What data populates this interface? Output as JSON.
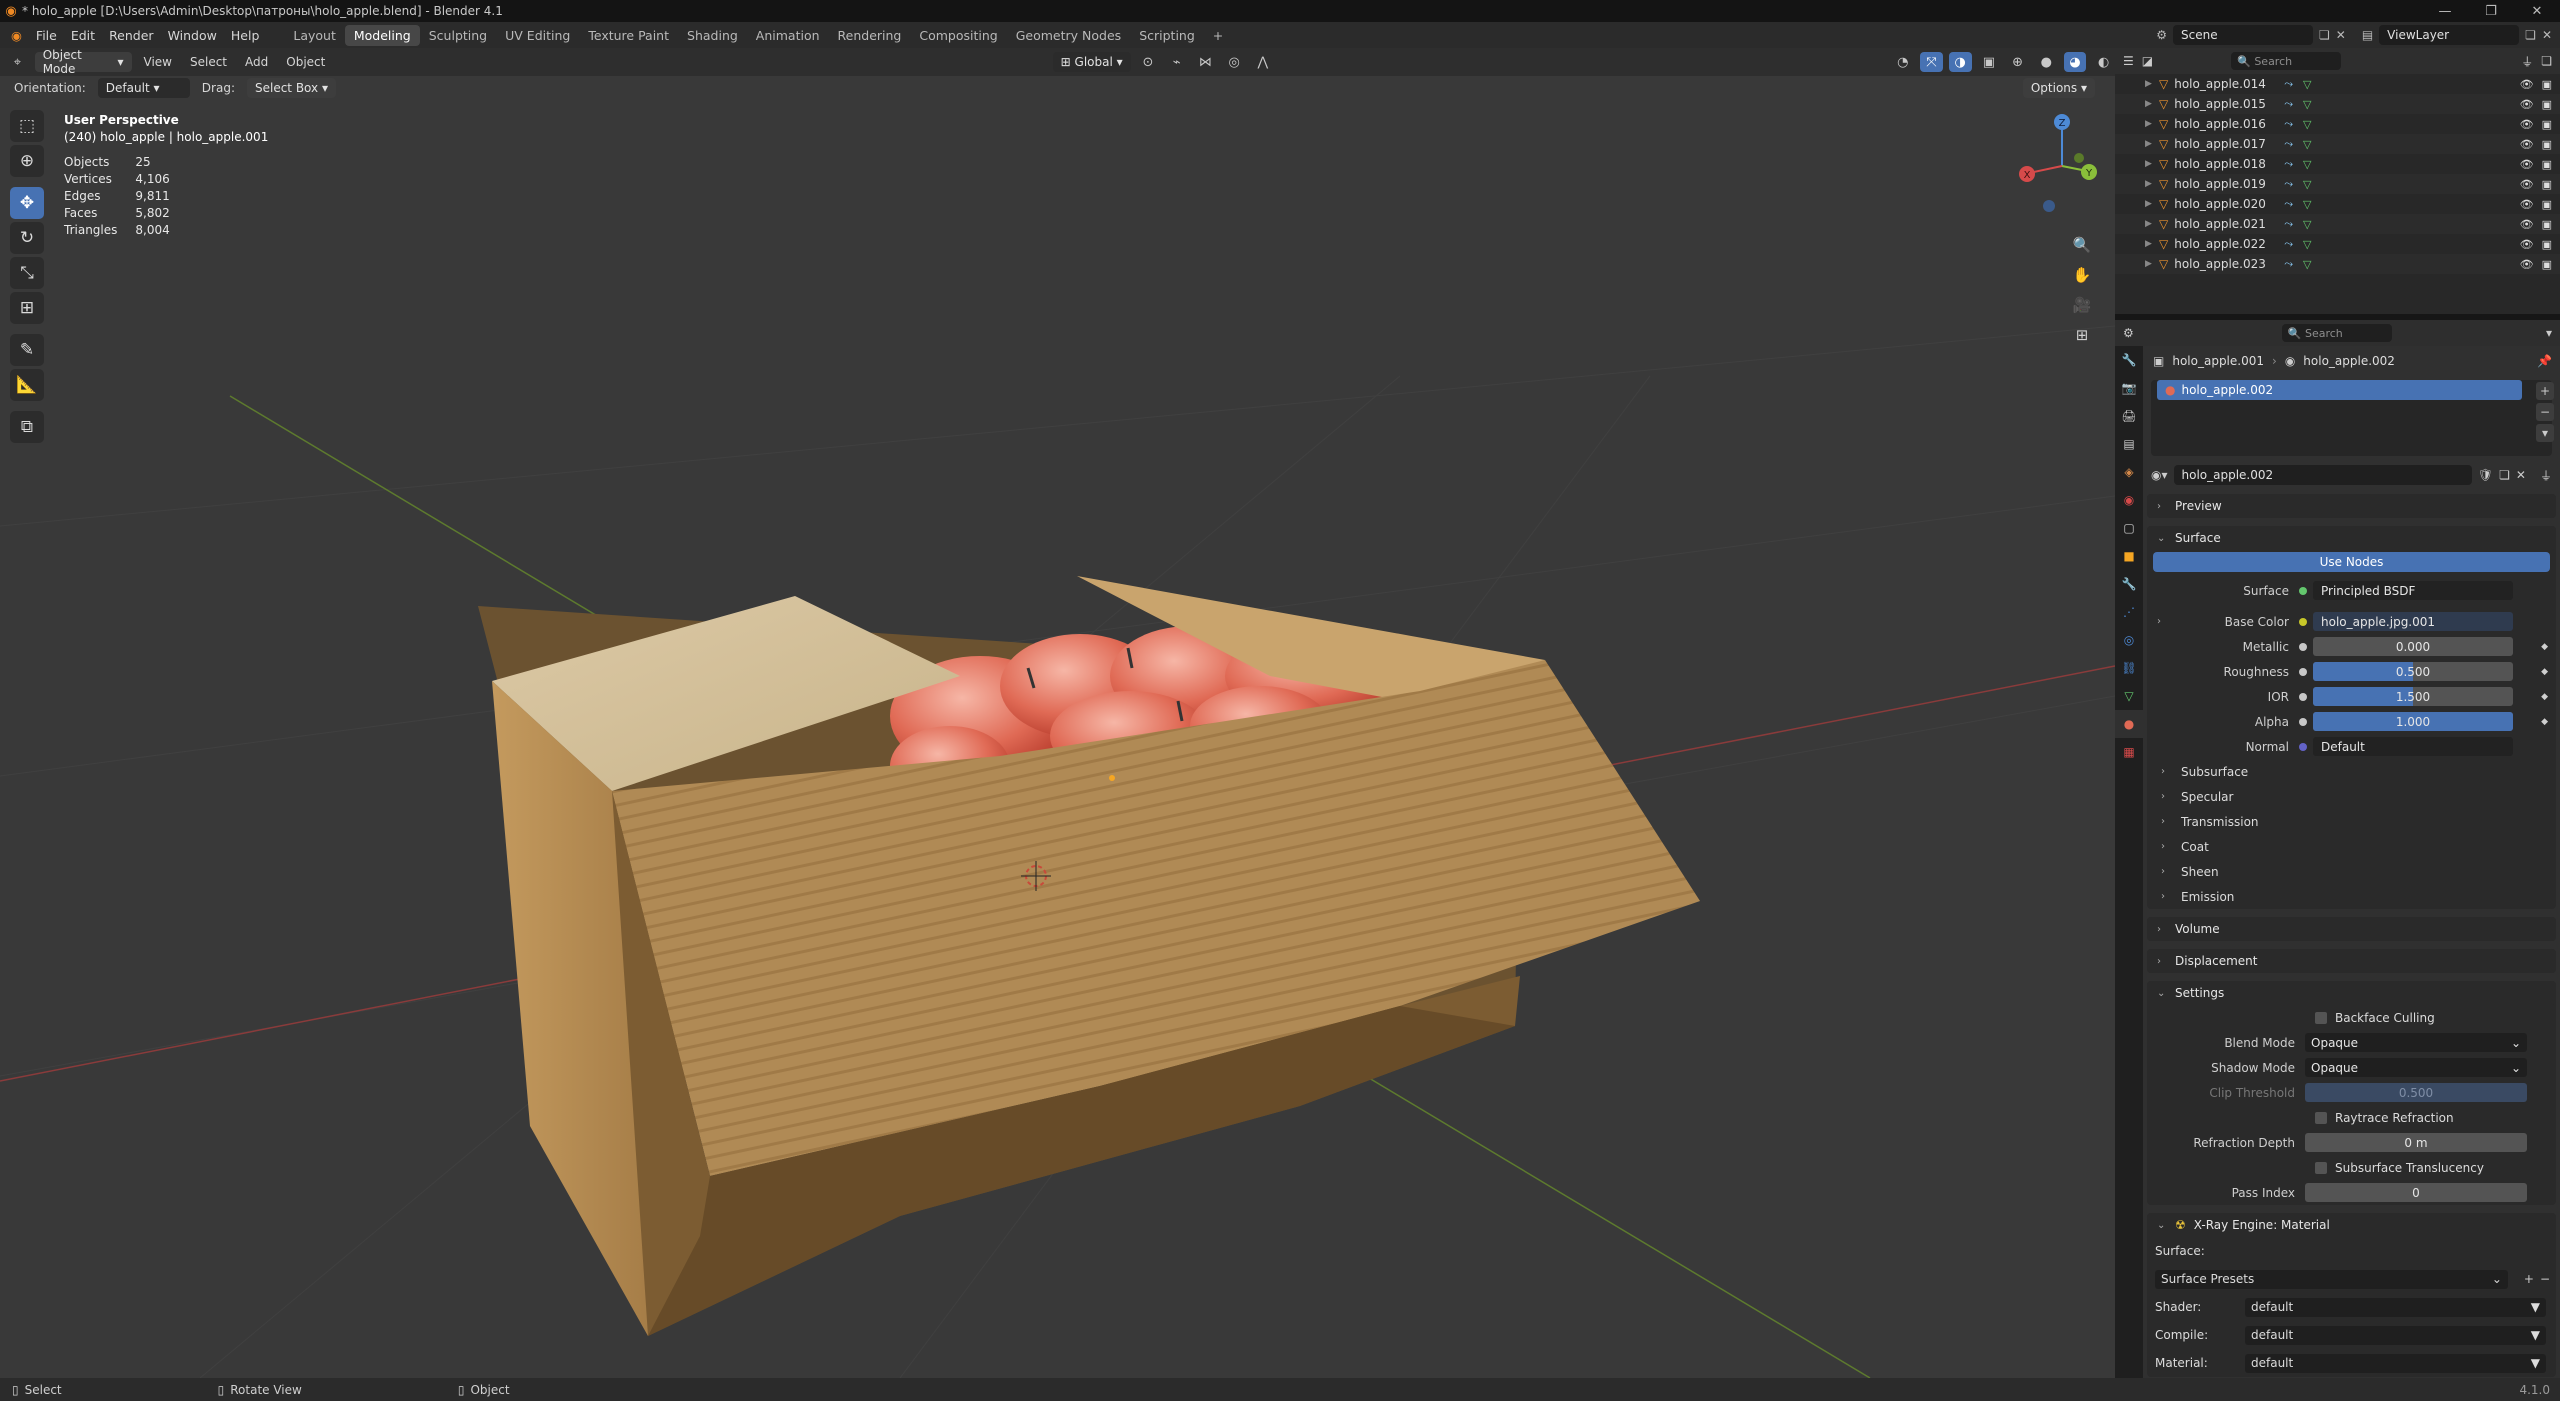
{
  "window": {
    "title": "* holo_apple [D:\\Users\\Admin\\Desktop\\патроны\\holo_apple.blend] - Blender 4.1"
  },
  "menu": [
    "File",
    "Edit",
    "Render",
    "Window",
    "Help"
  ],
  "workspaces": [
    "Layout",
    "Modeling",
    "Sculpting",
    "UV Editing",
    "Texture Paint",
    "Shading",
    "Animation",
    "Rendering",
    "Compositing",
    "Geometry Nodes",
    "Scripting"
  ],
  "active_workspace": "Modeling",
  "scene": {
    "name": "Scene",
    "view_layer": "ViewLayer"
  },
  "viewport_header": {
    "mode": "Object Mode",
    "menus": [
      "View",
      "Select",
      "Add",
      "Object"
    ],
    "transform_orientation": "Global",
    "orientation_label": "Orientation:",
    "orientation_value": "Default",
    "drag_label": "Drag:",
    "drag_value": "Select Box",
    "options": "Options"
  },
  "overlay": {
    "view_name": "User Perspective",
    "active": "(240) holo_apple | holo_apple.001",
    "stats": [
      {
        "label": "Objects",
        "value": "25"
      },
      {
        "label": "Vertices",
        "value": "4,106"
      },
      {
        "label": "Edges",
        "value": "9,811"
      },
      {
        "label": "Faces",
        "value": "5,802"
      },
      {
        "label": "Triangles",
        "value": "8,004"
      }
    ]
  },
  "gizmo": {
    "x": "X",
    "y": "Y",
    "z": "Z"
  },
  "outliner": {
    "search_placeholder": "Search",
    "items": [
      "holo_apple.014",
      "holo_apple.015",
      "holo_apple.016",
      "holo_apple.017",
      "holo_apple.018",
      "holo_apple.019",
      "holo_apple.020",
      "holo_apple.021",
      "holo_apple.022",
      "holo_apple.023"
    ]
  },
  "properties": {
    "search_placeholder": "Search",
    "breadcrumb_object": "holo_apple.001",
    "breadcrumb_material": "holo_apple.002",
    "slot_name": "holo_apple.002",
    "material_name": "holo_apple.002",
    "panels": {
      "preview": "Preview",
      "surface": "Surface",
      "use_nodes": "Use Nodes",
      "volume": "Volume",
      "displacement": "Displacement",
      "settings": "Settings",
      "xray": "X-Ray Engine: Material"
    },
    "surface_rows": [
      {
        "label": "Surface",
        "value": "Principled BSDF"
      },
      {
        "label": "Base Color",
        "value": "holo_apple.jpg.001"
      },
      {
        "label": "Metallic",
        "value": "0.000",
        "fraction": 0.0
      },
      {
        "label": "Roughness",
        "value": "0.500",
        "fraction": 0.5
      },
      {
        "label": "IOR",
        "value": "1.500",
        "fraction": 0.5
      },
      {
        "label": "Alpha",
        "value": "1.000",
        "fraction": 1.0
      },
      {
        "label": "Normal",
        "value": "Default"
      }
    ],
    "subpanels": [
      "Subsurface",
      "Specular",
      "Transmission",
      "Coat",
      "Sheen",
      "Emission"
    ],
    "settings": {
      "backface_culling": "Backface Culling",
      "blend_mode_label": "Blend Mode",
      "blend_mode": "Opaque",
      "shadow_mode_label": "Shadow Mode",
      "shadow_mode": "Opaque",
      "clip_threshold_label": "Clip Threshold",
      "clip_threshold": "0.500",
      "raytrace_refraction": "Raytrace Refraction",
      "refraction_depth_label": "Refraction Depth",
      "refraction_depth": "0 m",
      "subsurface_translucency": "Subsurface Translucency",
      "pass_index_label": "Pass Index",
      "pass_index": "0"
    },
    "xray": {
      "surface_label": "Surface:",
      "presets": "Surface Presets",
      "shader_label": "Shader:",
      "shader": "default",
      "compile_label": "Compile:",
      "compile": "default",
      "material_label": "Material:",
      "material": "default"
    }
  },
  "statusbar": {
    "select": "Select",
    "rotate": "Rotate View",
    "object": "Object",
    "version": "4.1.0"
  }
}
